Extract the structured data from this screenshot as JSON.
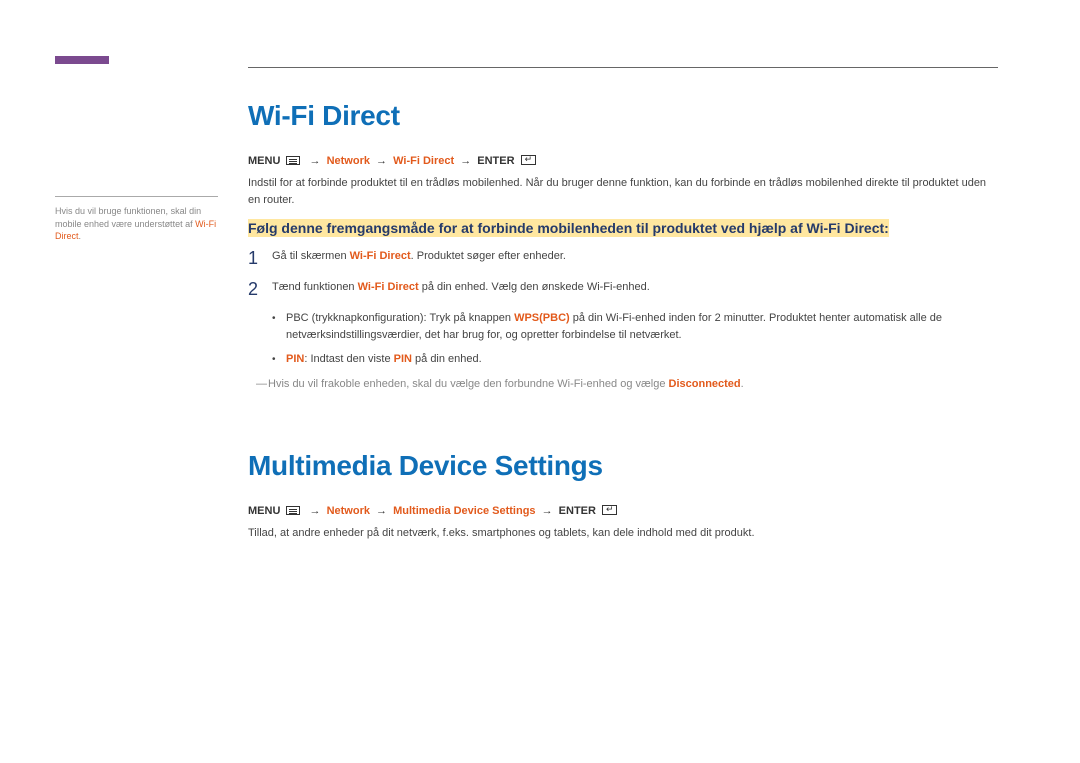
{
  "sidebar": {
    "note_pre": "Hvis du vil bruge funktionen, skal din mobile enhed være understøttet af ",
    "note_hl": "Wi-Fi Direct",
    "note_post": "."
  },
  "section1": {
    "heading": "Wi-Fi Direct",
    "menu_label": "MENU",
    "arrow": "→",
    "nav1": "Network",
    "nav2": "Wi-Fi Direct",
    "enter_label": "ENTER",
    "intro": "Indstil for at forbinde produktet til en trådløs mobilenhed. Når du bruger denne funktion, kan du forbinde en trådløs mobilenhed direkte til produktet uden en router.",
    "subhead": "Følg denne fremgangsmåde for at forbinde mobilenheden til produktet ved hjælp af Wi-Fi Direct:",
    "steps": [
      {
        "num": "1",
        "pre": "Gå til skærmen ",
        "hl": "Wi-Fi Direct",
        "post": ". Produktet søger efter enheder."
      },
      {
        "num": "2",
        "pre": "Tænd funktionen ",
        "hl": "Wi-Fi Direct",
        "post": " på din enhed. Vælg den ønskede Wi-Fi-enhed."
      }
    ],
    "subitems": [
      {
        "pre": "PBC (trykknapkonfiguration): Tryk på knappen ",
        "hl": "WPS(PBC)",
        "post": " på din Wi-Fi-enhed inden for 2 minutter. Produktet henter automatisk alle de netværksindstillingsværdier, det har brug for, og opretter forbindelse til netværket."
      },
      {
        "hl1": "PIN",
        "mid": ": Indtast den viste ",
        "hl2": "PIN",
        "post": " på din enhed."
      }
    ],
    "footnote_dash": "―",
    "footnote_pre": "Hvis du vil frakoble enheden, skal du vælge den forbundne Wi-Fi-enhed og vælge ",
    "footnote_hl": "Disconnected",
    "footnote_post": "."
  },
  "section2": {
    "heading": "Multimedia Device Settings",
    "nav1": "Network",
    "nav2": "Multimedia Device Settings",
    "intro": "Tillad, at andre enheder på dit netværk, f.eks. smartphones og tablets, kan dele indhold med dit produkt."
  }
}
